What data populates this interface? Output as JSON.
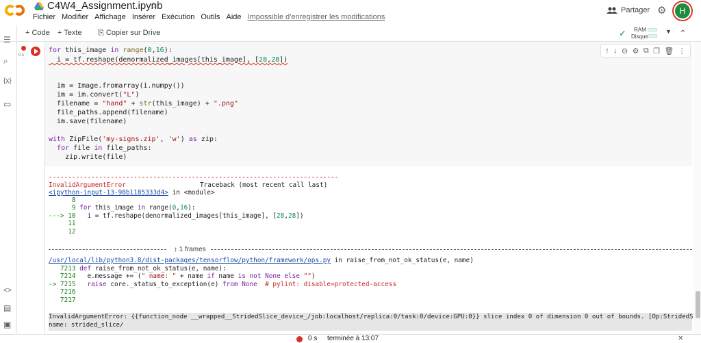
{
  "header": {
    "title": "C4W4_Assignment.ipynb",
    "menu": [
      "Fichier",
      "Modifier",
      "Affichage",
      "Insérer",
      "Exécution",
      "Outils",
      "Aide"
    ],
    "save_warning": "Impossible d'enregistrer les modifications",
    "share_label": "Partager",
    "avatar_letter": "H"
  },
  "toolbar": {
    "add_code": "+ Code",
    "add_text": "+ Texte",
    "copy_drive": "Copier sur Drive",
    "ram_label": "RAM",
    "disk_label": "Disque"
  },
  "cell": {
    "exec_time": "0 s",
    "lines": [
      "for this_image in range(0,16):",
      "  i = tf.reshape(denormalized_images[this_image], [28,28])",
      "",
      "",
      "  im = Image.fromarray(i.numpy())",
      "  im = im.convert(\"L\")",
      "  filename = \"hand\" + str(this_image) + \".png\"",
      "  file_paths.append(filename)",
      "  im.save(filename)",
      "",
      "with ZipFile('my-signs.zip', 'w') as zip:",
      "  for file in file_paths:",
      "    zip.write(file)"
    ]
  },
  "output": {
    "dashes": "---------------------------------------------------------------------------",
    "error_name": "InvalidArgumentError",
    "traceback_header": "Traceback (most recent call last)",
    "input_link": "<ipython-input-13-98b1185333d4>",
    "in_module": " in <module>",
    "trace_lines": [
      "      8",
      "      9 for this_image in range(0,16):",
      "---> 10   i = tf.reshape(denormalized_images[this_image], [28,28])",
      "     11",
      "     12"
    ],
    "frames_label": "1 frames",
    "ops_path": "/usr/local/lib/python3.8/dist-packages/tensorflow/python/framework/ops.py",
    "ops_in": " in raise_from_not_ok_status(e, name)",
    "ops_lines": [
      "   7213 def raise_from_not_ok_status(e, name):",
      "   7214   e.message += (\" name: \" + name if name is not None else \"\")",
      "-> 7215   raise core._status_to_exception(e) from None  # pylint: disable=protected-access",
      "   7216",
      "   7217"
    ],
    "final_error_1": "InvalidArgumentError: {{function_node __wrapped__StridedSlice_device_/job:localhost/replica:0/task:0/device:GPU:0}} slice index 0 of dimension 0 out of bounds. [Op:StridedSlice]",
    "final_error_2": "name: strided_slice/"
  },
  "statusbar": {
    "time": "0 s",
    "done": "terminée à 13:07"
  }
}
